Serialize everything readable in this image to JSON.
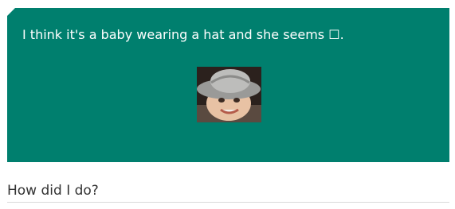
{
  "message": {
    "caption": "I think it's a baby wearing a hat and she seems ☐.",
    "image_alt": "baby wearing a hat"
  },
  "feedback": {
    "heading": "How did I do?"
  },
  "colors": {
    "card_background": "#007f6e",
    "caption_text": "#ffffff",
    "heading_text": "#333333"
  }
}
